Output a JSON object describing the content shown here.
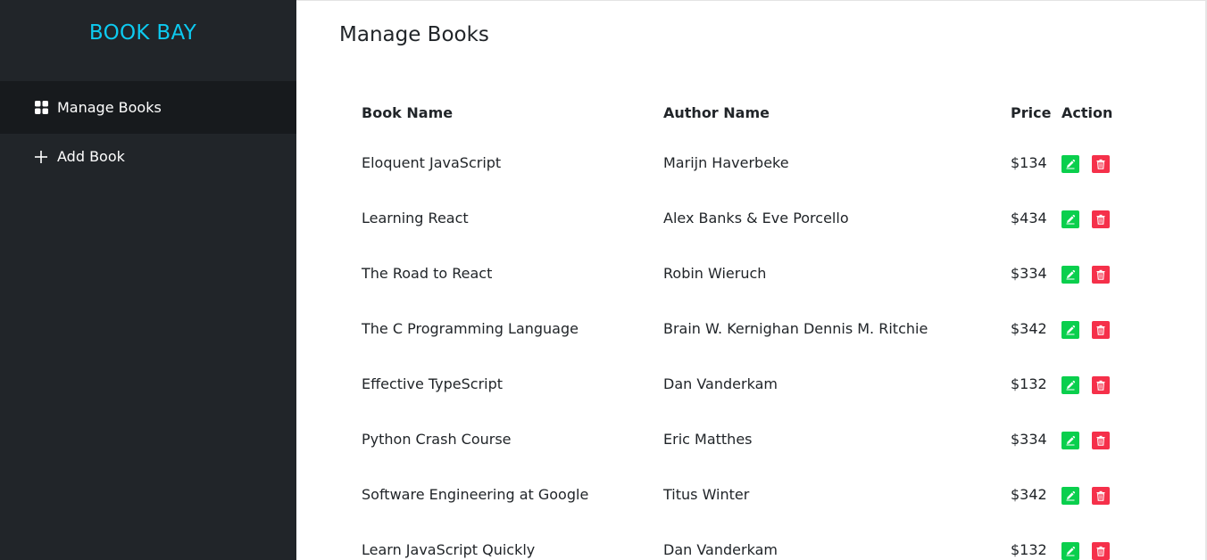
{
  "brand": {
    "name": "BOOK BAY",
    "color": "#0dcaf0"
  },
  "sidebar": {
    "items": [
      {
        "label": "Manage Books",
        "icon": "grid-icon",
        "active": true
      },
      {
        "label": "Add Book",
        "icon": "plus-icon",
        "active": false
      }
    ]
  },
  "main": {
    "title": "Manage Books",
    "table": {
      "headers": {
        "book": "Book Name",
        "author": "Author Name",
        "price": "Price",
        "action": "Action"
      },
      "rows": [
        {
          "book": "Eloquent JavaScript",
          "author": "Marijn Haverbeke",
          "price": "$134"
        },
        {
          "book": "Learning React",
          "author": "Alex Banks & Eve Porcello",
          "price": "$434"
        },
        {
          "book": "The Road to React",
          "author": "Robin Wieruch",
          "price": "$334"
        },
        {
          "book": "The C Programming Language",
          "author": "Brain W. Kernighan Dennis M. Ritchie",
          "price": "$342"
        },
        {
          "book": "Effective TypeScript",
          "author": "Dan Vanderkam",
          "price": "$132"
        },
        {
          "book": "Python Crash Course",
          "author": "Eric Matthes",
          "price": "$334"
        },
        {
          "book": "Software Engineering at Google",
          "author": "Titus Winter",
          "price": "$342"
        },
        {
          "book": "Learn JavaScript Quickly",
          "author": "Dan Vanderkam",
          "price": "$132"
        }
      ],
      "action_icons": {
        "edit": "pencil-icon",
        "delete": "trash-icon"
      },
      "colors": {
        "edit": "#0acf4d",
        "delete": "#f5304a"
      }
    }
  }
}
